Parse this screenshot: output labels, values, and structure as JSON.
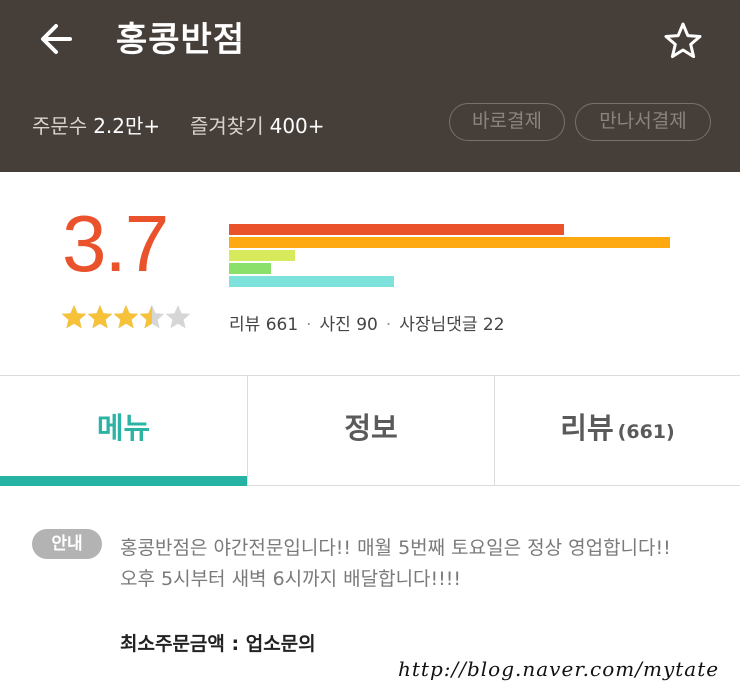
{
  "header": {
    "title": "홍콩반점",
    "orders_label": "주문수",
    "orders_value": "2.2만+",
    "favorites_label": "즐겨찾기",
    "favorites_value": "400+",
    "pay_direct": "바로결제",
    "pay_meet": "만나서결제",
    "back_icon": "arrow-left-icon",
    "fav_icon": "star-outline-icon"
  },
  "rating": {
    "score": "3.7",
    "stars_value": 3.5,
    "stars_max": 5,
    "review_label": "리뷰",
    "review_count": "661",
    "photo_label": "사진",
    "photo_count": "90",
    "owner_reply_label": "사장님댓글",
    "owner_reply_count": "22",
    "distribution": [
      {
        "value": 0.76,
        "color": "#e9522a"
      },
      {
        "value": 1.0,
        "color": "#ffa912"
      },
      {
        "value": 0.15,
        "color": "#d6ea5c"
      },
      {
        "value": 0.095,
        "color": "#8be06c"
      },
      {
        "value": 0.375,
        "color": "#7ee2dc"
      }
    ],
    "colors": {
      "score": "#e9522a",
      "star_filled": "#f6c23a",
      "star_empty": "#d6d6d6"
    }
  },
  "tabs": [
    {
      "label": "메뉴",
      "active": true
    },
    {
      "label": "정보",
      "active": false
    },
    {
      "label": "리뷰",
      "count": "(661)",
      "active": false
    }
  ],
  "notice": {
    "badge": "안내",
    "line1": "홍콩반점은 야간전문입니다!! 매월 5번째 토요일은 정상 영업합니다!!",
    "line2": "오후 5시부터 새벽 6시까지 배달합니다!!!!",
    "min_order": "최소주문금액 : 업소문의",
    "watermark": "http://blog.naver.com/mytate"
  }
}
